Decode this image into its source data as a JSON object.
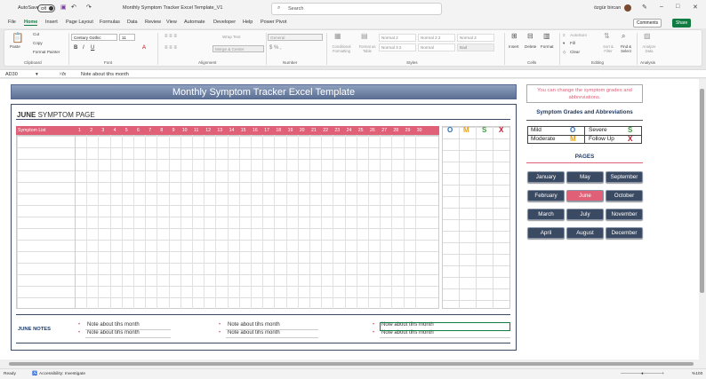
{
  "window": {
    "autosave": "AutoSave",
    "autosave_state": "Off",
    "file_title": "Monthly Symptom Tracker Excel Template_V1",
    "search_placeholder": "Search",
    "user": "özgür bircan"
  },
  "menu": [
    "File",
    "Home",
    "Insert",
    "Page Layout",
    "Formulas",
    "Data",
    "Review",
    "View",
    "Automate",
    "Developer",
    "Help",
    "Power Pivot"
  ],
  "top_buttons": {
    "comments": "Comments",
    "share": "Share"
  },
  "ribbon": {
    "paste": "Paste",
    "cut": "Cut",
    "copy": "Copy",
    "format_painter": "Format Painter",
    "clipboard": "Clipboard",
    "font_name": "Century Gothic",
    "font_size": "11",
    "font": "Font",
    "wrap_text": "Wrap Text",
    "merge_center": "Merge & Center",
    "alignment": "Alignment",
    "number_format": "General",
    "number": "Number",
    "conditional": "Conditional Formatting",
    "format_as_table": "Format as Table",
    "styles_cells": [
      "Normal 2",
      "Normal 2 2",
      "Normal 3",
      "Normal 3 2",
      "Normal",
      "Bad"
    ],
    "styles": "Styles",
    "insert": "Insert",
    "delete": "Delete",
    "format": "Format",
    "cells": "Cells",
    "autosum": "AutoSum",
    "fill": "Fill",
    "clear": "Clear",
    "sort_filter": "Sort & Filter",
    "find_select": "Find & Select",
    "editing": "Editing",
    "analyze": "Analyze Data",
    "analysis": "Analysis"
  },
  "formula_bar": {
    "name_box": "AD30",
    "fx": "fx",
    "content": "Note about tihs month"
  },
  "template": {
    "title": "Monthly Symptom Tracker Excel Template",
    "page_month": "JUNE",
    "page_label": "SYMPTOM PAGE",
    "symptom_list": "Symptom List",
    "days": [
      "1",
      "2",
      "3",
      "4",
      "5",
      "6",
      "7",
      "8",
      "9",
      "10",
      "11",
      "12",
      "13",
      "14",
      "15",
      "16",
      "17",
      "18",
      "19",
      "20",
      "21",
      "22",
      "23",
      "24",
      "25",
      "26",
      "27",
      "28",
      "29",
      "30"
    ],
    "grade_cols": [
      "O",
      "M",
      "S",
      "X"
    ],
    "notes_label": "JUNE NOTES",
    "notes": [
      "Note about tihs month",
      "Note about tihs month",
      "Note about tihs month",
      "Note about tihs month",
      "Note about tihs month",
      "Note about tihs month"
    ],
    "info": "You can change the symptom grades and abbreviations.",
    "grades_title": "Symptom Grades and Abbreviations",
    "grades": [
      {
        "name": "Mild",
        "abbr": "O",
        "color": "#2f6eb5"
      },
      {
        "name": "Severe",
        "abbr": "S",
        "color": "#3a9a3a"
      },
      {
        "name": "Moderate",
        "abbr": "M",
        "color": "#e8a020"
      },
      {
        "name": "Follow Up",
        "abbr": "X",
        "color": "#c0182c"
      }
    ],
    "pages_title": "PAGES",
    "months": [
      "January",
      "May",
      "September",
      "February",
      "June",
      "October",
      "March",
      "July",
      "November",
      "April",
      "August",
      "December"
    ],
    "active_month": "June"
  },
  "status": {
    "ready": "Ready",
    "accessibility": "Accessibility: Investigate",
    "zoom": "%100"
  }
}
